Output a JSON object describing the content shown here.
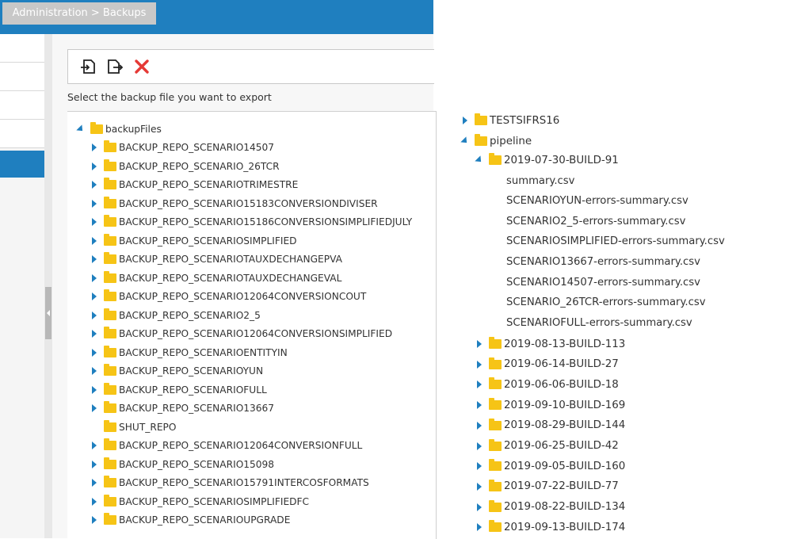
{
  "header": {
    "breadcrumb": "Administration > Backups"
  },
  "toolbar": {
    "import_icon": "import-icon",
    "export_icon": "export-icon",
    "delete_icon": "delete-icon",
    "delete_color": "#e53935"
  },
  "instruction": "Select the backup file you want to export",
  "tree": {
    "root": "backupFiles",
    "items": [
      "BACKUP_REPO_SCENARIO14507",
      "BACKUP_REPO_SCENARIO_26TCR",
      "BACKUP_REPO_SCENARIOTRIMESTRE",
      "BACKUP_REPO_SCENARIO15183CONVERSIONDIVISER",
      "BACKUP_REPO_SCENARIO15186CONVERSIONSIMPLIFIEDJULY",
      "BACKUP_REPO_SCENARIOSIMPLIFIED",
      "BACKUP_REPO_SCENARIOTAUXDECHANGEPVA",
      "BACKUP_REPO_SCENARIOTAUXDECHANGEVAL",
      "BACKUP_REPO_SCENARIO12064CONVERSIONCOUT",
      "BACKUP_REPO_SCENARIO2_5",
      "BACKUP_REPO_SCENARIO12064CONVERSIONSIMPLIFIED",
      "BACKUP_REPO_SCENARIOENTITYIN",
      "BACKUP_REPO_SCENARIOYUN",
      "BACKUP_REPO_SCENARIOFULL",
      "BACKUP_REPO_SCENARIO13667",
      "SHUT_REPO",
      "BACKUP_REPO_SCENARIO12064CONVERSIONFULL",
      "BACKUP_REPO_SCENARIO15098",
      "BACKUP_REPO_SCENARIO15791INTERCOSFORMATS",
      "BACKUP_REPO_SCENARIOSIMPLIFIEDFC",
      "BACKUP_REPO_SCENARIOUPGRADE"
    ]
  },
  "right_tree": {
    "top_folders": [
      "TESTSIFRS16",
      "pipeline"
    ],
    "expanded_build": "2019-07-30-BUILD-91",
    "files": [
      "summary.csv",
      "SCENARIOYUN-errors-summary.csv",
      "SCENARIO2_5-errors-summary.csv",
      "SCENARIOSIMPLIFIED-errors-summary.csv",
      "SCENARIO13667-errors-summary.csv",
      "SCENARIO14507-errors-summary.csv",
      "SCENARIO_26TCR-errors-summary.csv",
      "SCENARIOFULL-errors-summary.csv"
    ],
    "builds": [
      "2019-08-13-BUILD-113",
      "2019-06-14-BUILD-27",
      "2019-06-06-BUILD-18",
      "2019-09-10-BUILD-169",
      "2019-08-29-BUILD-144",
      "2019-06-25-BUILD-42",
      "2019-09-05-BUILD-160",
      "2019-07-22-BUILD-77",
      "2019-08-22-BUILD-134",
      "2019-09-13-BUILD-174"
    ]
  }
}
